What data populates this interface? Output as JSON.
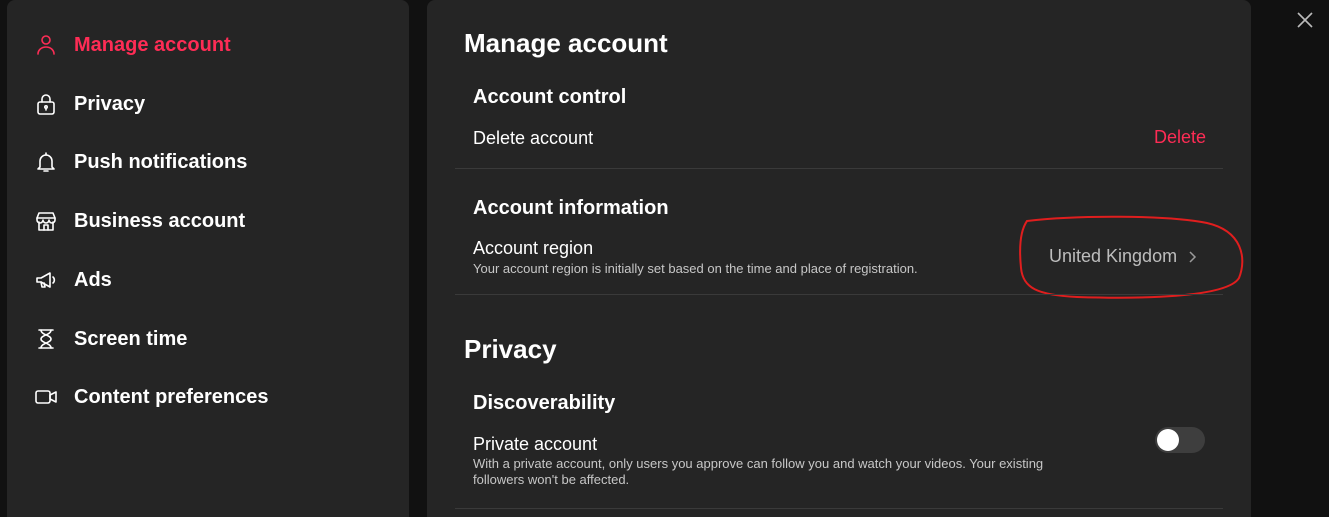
{
  "sidebar": {
    "items": [
      {
        "label": "Manage account",
        "icon": "person-icon"
      },
      {
        "label": "Privacy",
        "icon": "lock-icon"
      },
      {
        "label": "Push notifications",
        "icon": "bell-icon"
      },
      {
        "label": "Business account",
        "icon": "store-icon"
      },
      {
        "label": "Ads",
        "icon": "megaphone-icon"
      },
      {
        "label": "Screen time",
        "icon": "hourglass-icon"
      },
      {
        "label": "Content preferences",
        "icon": "video-camera-icon"
      }
    ],
    "active_index": 0
  },
  "main": {
    "title": "Manage account",
    "account_control": {
      "heading": "Account control",
      "delete_row_label": "Delete account",
      "delete_action": "Delete"
    },
    "account_information": {
      "heading": "Account information",
      "region_label": "Account region",
      "region_desc": "Your account region is initially set based on the time and place of registration.",
      "region_value": "United Kingdom"
    },
    "privacy": {
      "title": "Privacy",
      "heading": "Discoverability",
      "private_label": "Private account",
      "private_desc_line1": "With a private account, only users you approve can follow you and watch your videos. Your existing",
      "private_desc_line2": "followers won't be affected.",
      "private_enabled": false
    }
  },
  "colors": {
    "accent": "#fe2c55",
    "panel": "#252525",
    "background": "#111111",
    "annotation": "#e01e1e"
  },
  "close_icon": "close-icon"
}
